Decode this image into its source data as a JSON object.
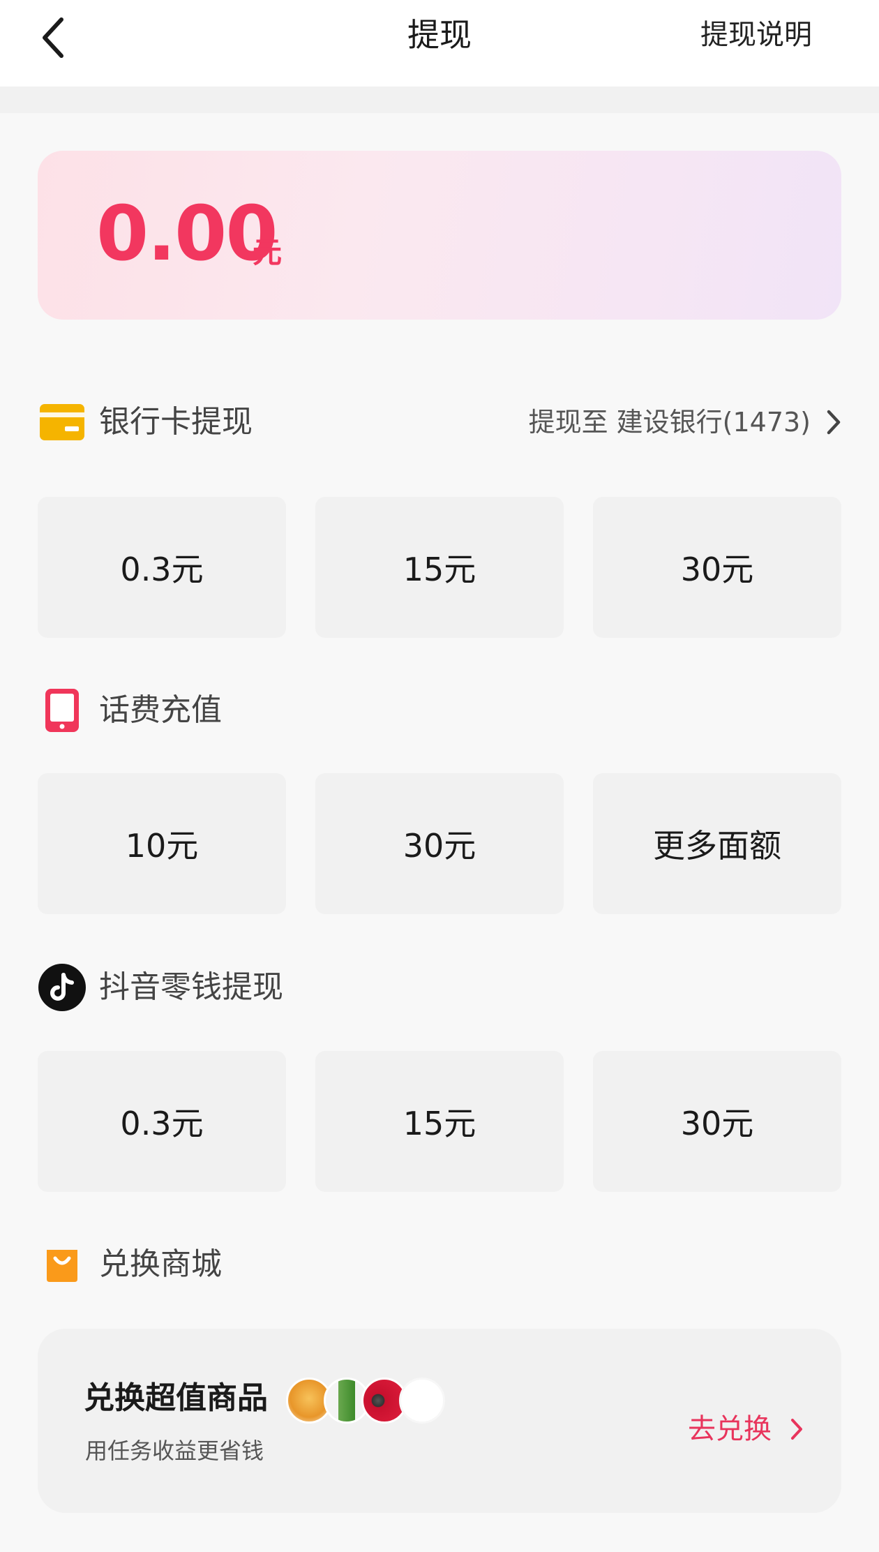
{
  "header": {
    "title": "提现",
    "help_label": "提现说明"
  },
  "balance": {
    "amount": "0.00",
    "unit": "元"
  },
  "colors": {
    "accent": "#f2375f",
    "bank_icon": "#f5b400",
    "phone_icon": "#f0365a",
    "mall_icon": "#fa9a1a",
    "option_bg": "#f1f1f1"
  },
  "sections": {
    "bank": {
      "title": "银行卡提现",
      "target_label": "提现至 建设银行(1473)",
      "icon": "bank-card-icon",
      "options": [
        "0.3元",
        "15元",
        "30元"
      ]
    },
    "phone": {
      "title": "话费充值",
      "icon": "phone-icon",
      "options": [
        "10元",
        "30元",
        "更多面额"
      ]
    },
    "douyin": {
      "title": "抖音零钱提现",
      "icon": "douyin-icon",
      "options": [
        "0.3元",
        "15元",
        "30元"
      ]
    },
    "mall": {
      "title": "兑换商城",
      "icon": "shopping-bag-icon",
      "card_title": "兑换超值商品",
      "card_subtitle": "用任务收益更省钱",
      "action_label": "去兑换"
    }
  }
}
